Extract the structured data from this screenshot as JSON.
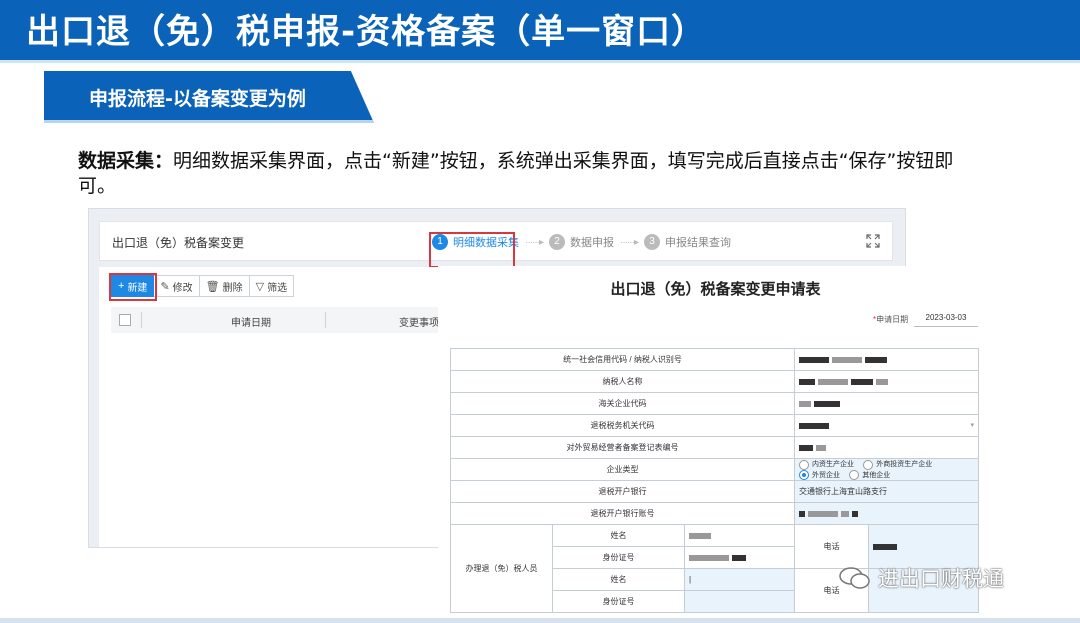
{
  "slide": {
    "title": "出口退（免）税申报-资格备案（单一窗口）",
    "subtitle": "申报流程-以备案变更为例",
    "desc_label": "数据采集：",
    "desc_text": "明细数据采集界面，点击“新建”按钮，系统弹出采集界面，填写完成后直接点击“保存”按钮即可。"
  },
  "app": {
    "title": "出口退（免）税备案变更",
    "steps": [
      {
        "num": "1",
        "label": "明细数据采集"
      },
      {
        "num": "2",
        "label": "数据申报"
      },
      {
        "num": "3",
        "label": "申报结果查询"
      }
    ],
    "step_arrow": "······▸",
    "toolbar": {
      "new": "新建",
      "edit": "修改",
      "delete": "删除",
      "filter": "筛选"
    },
    "columns": [
      "申请日期",
      "变更事项"
    ]
  },
  "form": {
    "title": "出口退（免）税备案变更申请表",
    "date_label": "申请日期",
    "date_value": "2023-03-03",
    "rows": {
      "credit_code": "统一社会信用代码 / 纳税人识别号",
      "taxpayer_name": "纳税人名称",
      "customs_code": "海关企业代码",
      "tax_office": "退税税务机关代码",
      "foreign_trade_no": "对外贸易经营者备案登记表编号",
      "enterprise_type": "企业类型",
      "bank": "退税开户银行",
      "bank_value": "交通银行上海宜山路支行",
      "account": "退税开户银行账号",
      "handler": "办理退（免）税人员",
      "name": "姓名",
      "id_no": "身份证号",
      "phone": "电话"
    },
    "enterprise_options": [
      "内资生产企业",
      "外商投资生产企业",
      "外贸企业",
      "其他企业"
    ],
    "enterprise_selected": "外贸企业"
  },
  "watermark": "进出口财税通"
}
